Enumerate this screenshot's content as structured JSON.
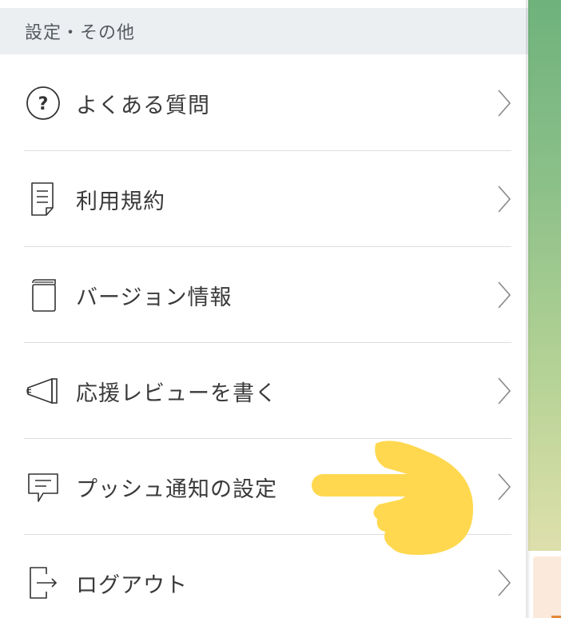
{
  "section": {
    "title": "設定・その他"
  },
  "menu": {
    "items": [
      {
        "label": "よくある質問",
        "icon": "question-circle-icon"
      },
      {
        "label": "利用規約",
        "icon": "document-icon"
      },
      {
        "label": "バージョン情報",
        "icon": "book-icon"
      },
      {
        "label": "応援レビューを書く",
        "icon": "megaphone-icon"
      },
      {
        "label": "プッシュ通知の設定",
        "icon": "speech-bubble-icon"
      },
      {
        "label": "ログアウト",
        "icon": "logout-icon"
      }
    ]
  },
  "colors": {
    "section_bg": "#eceff2",
    "text": "#3a3a3a",
    "divider": "#dedede",
    "pointer_hand": "#ffd84f",
    "backdrop_green": "#8cc089"
  }
}
